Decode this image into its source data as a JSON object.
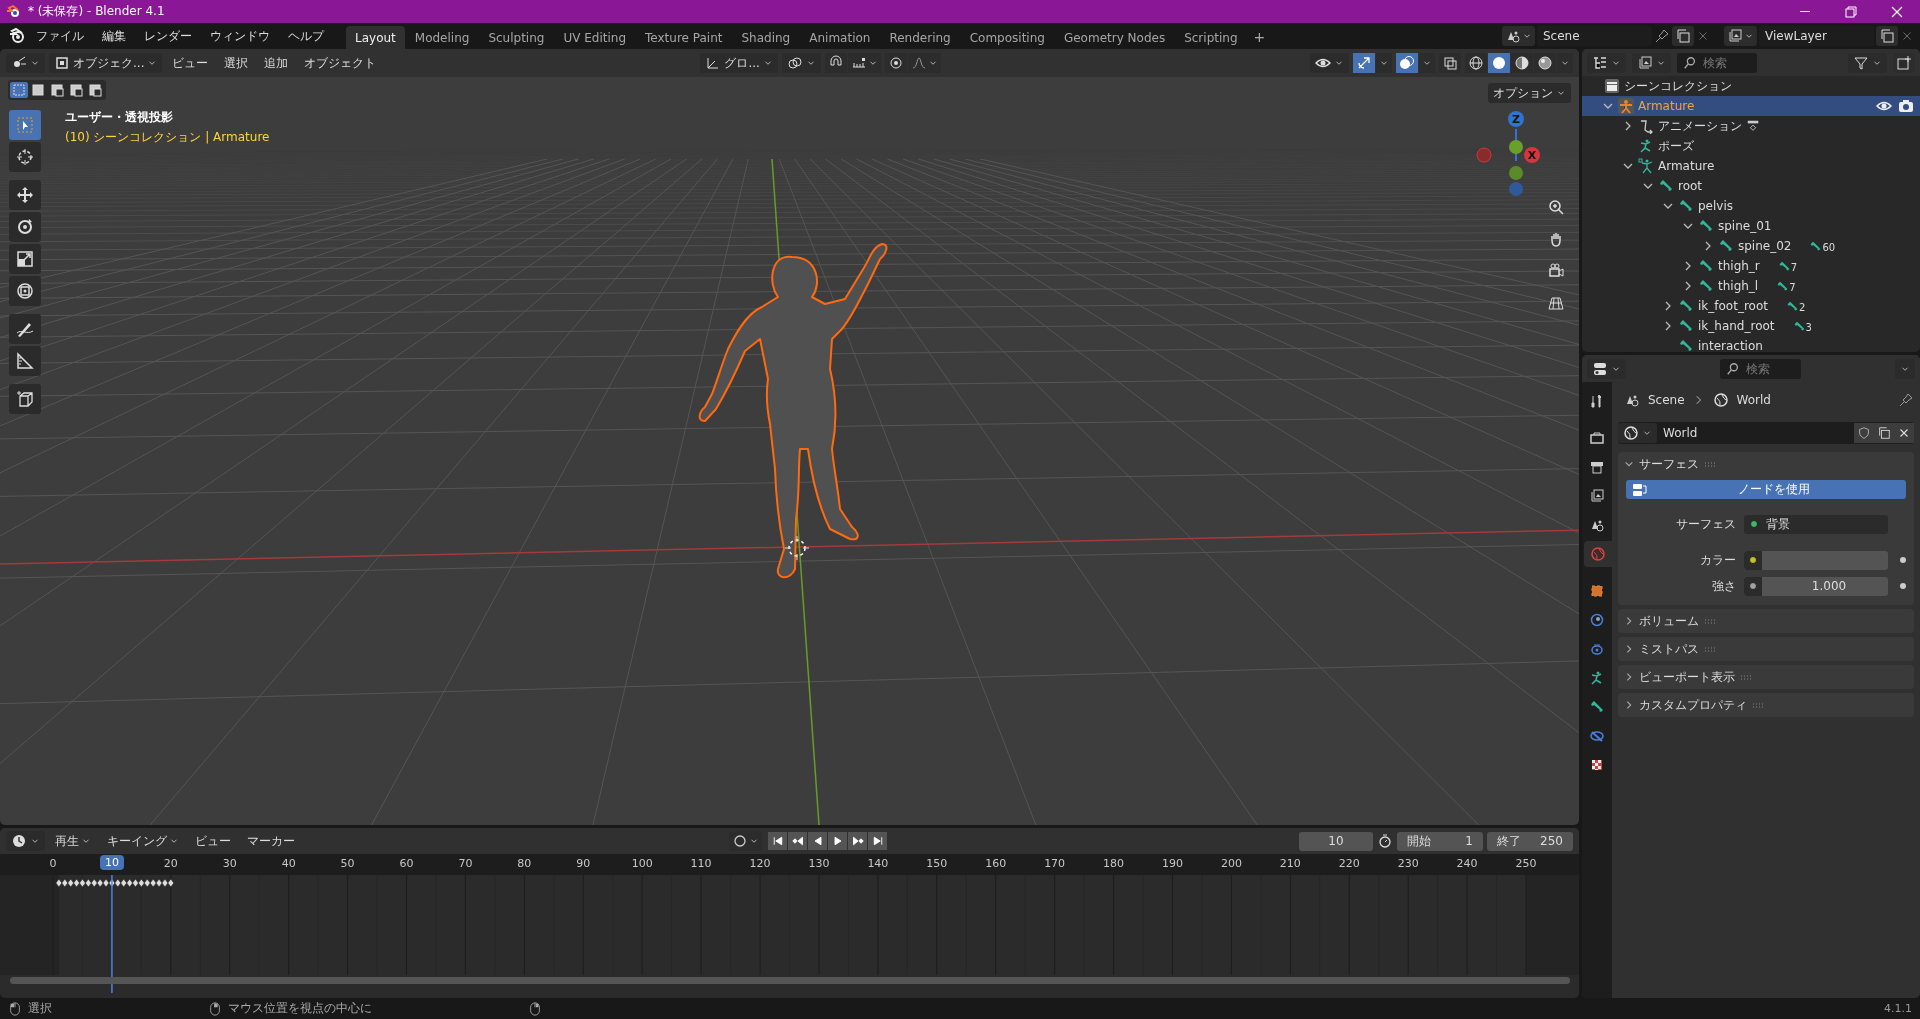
{
  "window": {
    "title": "* (未保存) - Blender 4.1"
  },
  "menu": [
    "ファイル",
    "編集",
    "レンダー",
    "ウィンドウ",
    "ヘルプ"
  ],
  "workspaces": [
    {
      "label": "Layout",
      "selected": true
    },
    {
      "label": "Modeling",
      "selected": false
    },
    {
      "label": "Sculpting",
      "selected": false
    },
    {
      "label": "UV Editing",
      "selected": false
    },
    {
      "label": "Texture Paint",
      "selected": false
    },
    {
      "label": "Shading",
      "selected": false
    },
    {
      "label": "Animation",
      "selected": false
    },
    {
      "label": "Rendering",
      "selected": false
    },
    {
      "label": "Compositing",
      "selected": false
    },
    {
      "label": "Geometry Nodes",
      "selected": false
    },
    {
      "label": "Scripting",
      "selected": false
    }
  ],
  "add_workspace": "+",
  "scene": "Scene",
  "view_layer": "ViewLayer",
  "viewport": {
    "mode": "オブジェク...",
    "menus": [
      "ビュー",
      "選択",
      "追加",
      "オブジェクト"
    ],
    "orientation": "グロ...",
    "options": "オプション",
    "view_name": "ユーザー・透視投影",
    "context": "(10) シーンコレクション | Armature",
    "select_modes": [
      {
        "selected": true
      },
      {
        "selected": false
      },
      {
        "selected": false
      },
      {
        "selected": false
      },
      {
        "selected": false
      }
    ],
    "tools": [
      {
        "kind": "select",
        "selected": true
      },
      {
        "kind": "cursor",
        "selected": false
      },
      {
        "kind": "move",
        "selected": false
      },
      {
        "kind": "rotate",
        "selected": false
      },
      {
        "kind": "scale",
        "selected": false
      },
      {
        "kind": "transform",
        "selected": false
      },
      {
        "kind": "annotate",
        "selected": false
      },
      {
        "kind": "measure",
        "selected": false
      },
      {
        "kind": "add-cube",
        "selected": false
      }
    ],
    "gizmo": [
      {
        "label": "Z",
        "color": "#2f74d0"
      },
      {
        "label": "X",
        "color": "#d5363e"
      }
    ]
  },
  "outliner": {
    "search_placeholder": "検索",
    "root": "シーンコレクション",
    "tree": [
      {
        "label": "Armature",
        "kind": "object",
        "selected": true,
        "expanded": true,
        "children": [
          {
            "label": "アニメーション",
            "kind": "animation",
            "selected": false,
            "expanded": false
          },
          {
            "label": "ポーズ",
            "kind": "pose",
            "selected": false
          },
          {
            "label": "Armature",
            "kind": "armature",
            "selected": false,
            "expanded": true,
            "children": [
              {
                "label": "root",
                "kind": "bone",
                "selected": false,
                "expanded": true,
                "children": [
                  {
                    "label": "pelvis",
                    "kind": "bone",
                    "selected": false,
                    "expanded": true,
                    "children": [
                      {
                        "label": "spine_01",
                        "kind": "bone",
                        "selected": false,
                        "expanded": true,
                        "children": [
                          {
                            "label": "spine_02",
                            "kind": "bone",
                            "selected": false,
                            "expanded": false,
                            "badge": "60"
                          }
                        ]
                      },
                      {
                        "label": "thigh_r",
                        "kind": "bone",
                        "selected": false,
                        "expanded": false,
                        "badge": "7"
                      },
                      {
                        "label": "thigh_l",
                        "kind": "bone",
                        "selected": false,
                        "expanded": false,
                        "badge": "7"
                      }
                    ]
                  },
                  {
                    "label": "ik_foot_root",
                    "kind": "bone",
                    "selected": false,
                    "expanded": false,
                    "badge": "2"
                  },
                  {
                    "label": "ik_hand_root",
                    "kind": "bone",
                    "selected": false,
                    "expanded": false,
                    "badge": "3"
                  },
                  {
                    "label": "interaction",
                    "kind": "bone",
                    "selected": false
                  }
                ]
              }
            ]
          }
        ]
      }
    ]
  },
  "properties": {
    "search_placeholder": "検索",
    "tabs": [
      {
        "kind": "tool",
        "selected": false
      },
      {
        "kind": "render",
        "selected": false
      },
      {
        "kind": "output",
        "selected": false
      },
      {
        "kind": "view-layer",
        "selected": false
      },
      {
        "kind": "scene",
        "selected": false
      },
      {
        "kind": "world",
        "selected": true
      },
      {
        "kind": "object",
        "selected": false
      },
      {
        "kind": "physics",
        "selected": false
      },
      {
        "kind": "constraints",
        "selected": false
      },
      {
        "kind": "pose",
        "selected": false
      },
      {
        "kind": "bone",
        "selected": false
      },
      {
        "kind": "bone-constraint",
        "selected": false
      },
      {
        "kind": "texture",
        "selected": false
      }
    ],
    "breadcrumb": [
      "Scene",
      "World"
    ],
    "datablock": "World",
    "use_nodes": "ノードを使用",
    "panels": [
      {
        "title": "サーフェス",
        "expanded": true
      },
      {
        "title": "ボリューム",
        "expanded": false
      },
      {
        "title": "ミストパス",
        "expanded": false
      },
      {
        "title": "ビューポート表示",
        "expanded": false
      },
      {
        "title": "カスタムプロパティ",
        "expanded": false
      }
    ],
    "fields": [
      {
        "label": "サーフェス",
        "kind": "shader",
        "value": "背景",
        "color": "#3fb86a"
      },
      {
        "label": "カラー",
        "kind": "color",
        "color": "#c8c31e"
      },
      {
        "label": "強さ",
        "kind": "number",
        "value": "1.000",
        "color": "#a0a0a0"
      }
    ]
  },
  "timeline": {
    "menus": [
      "再生",
      "キーイング",
      "ビュー",
      "マーカー"
    ],
    "current_frame": "10",
    "start_label": "開始",
    "start": "1",
    "end_label": "終了",
    "end": "250",
    "playhead": "10",
    "ticks": [
      "0",
      "20",
      "30",
      "40",
      "50",
      "60",
      "70",
      "80",
      "90",
      "100",
      "110",
      "120",
      "130",
      "140",
      "150",
      "160",
      "170",
      "180",
      "190",
      "200",
      "210",
      "220",
      "230",
      "240",
      "250"
    ]
  },
  "status_bar": {
    "items": [
      "選択",
      "マウス位置を視点の中心に"
    ],
    "version": "4.1.1"
  }
}
